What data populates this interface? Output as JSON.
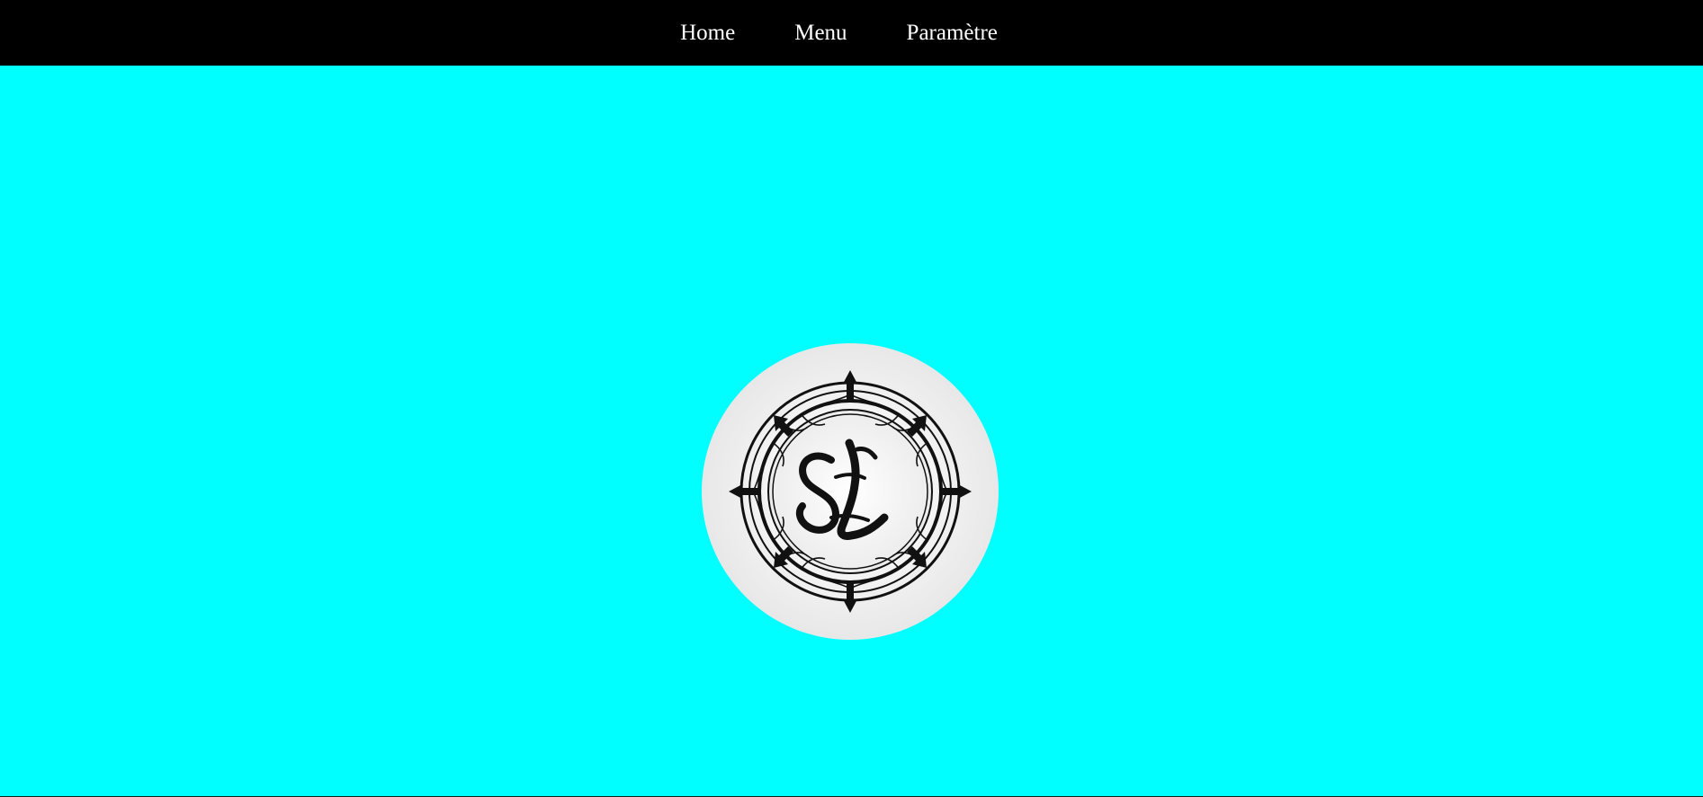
{
  "navbar": {
    "items": [
      {
        "label": "Home"
      },
      {
        "label": "Menu"
      },
      {
        "label": "Paramètre"
      }
    ]
  },
  "logo": {
    "monogram": "SL",
    "icon": "ornate-monogram-emblem-icon"
  },
  "colors": {
    "background": "#00ffff",
    "navbar": "#000000",
    "nav_text": "#ffffff",
    "logo_circle": "#e6e6e6",
    "logo_ink": "#111111"
  }
}
